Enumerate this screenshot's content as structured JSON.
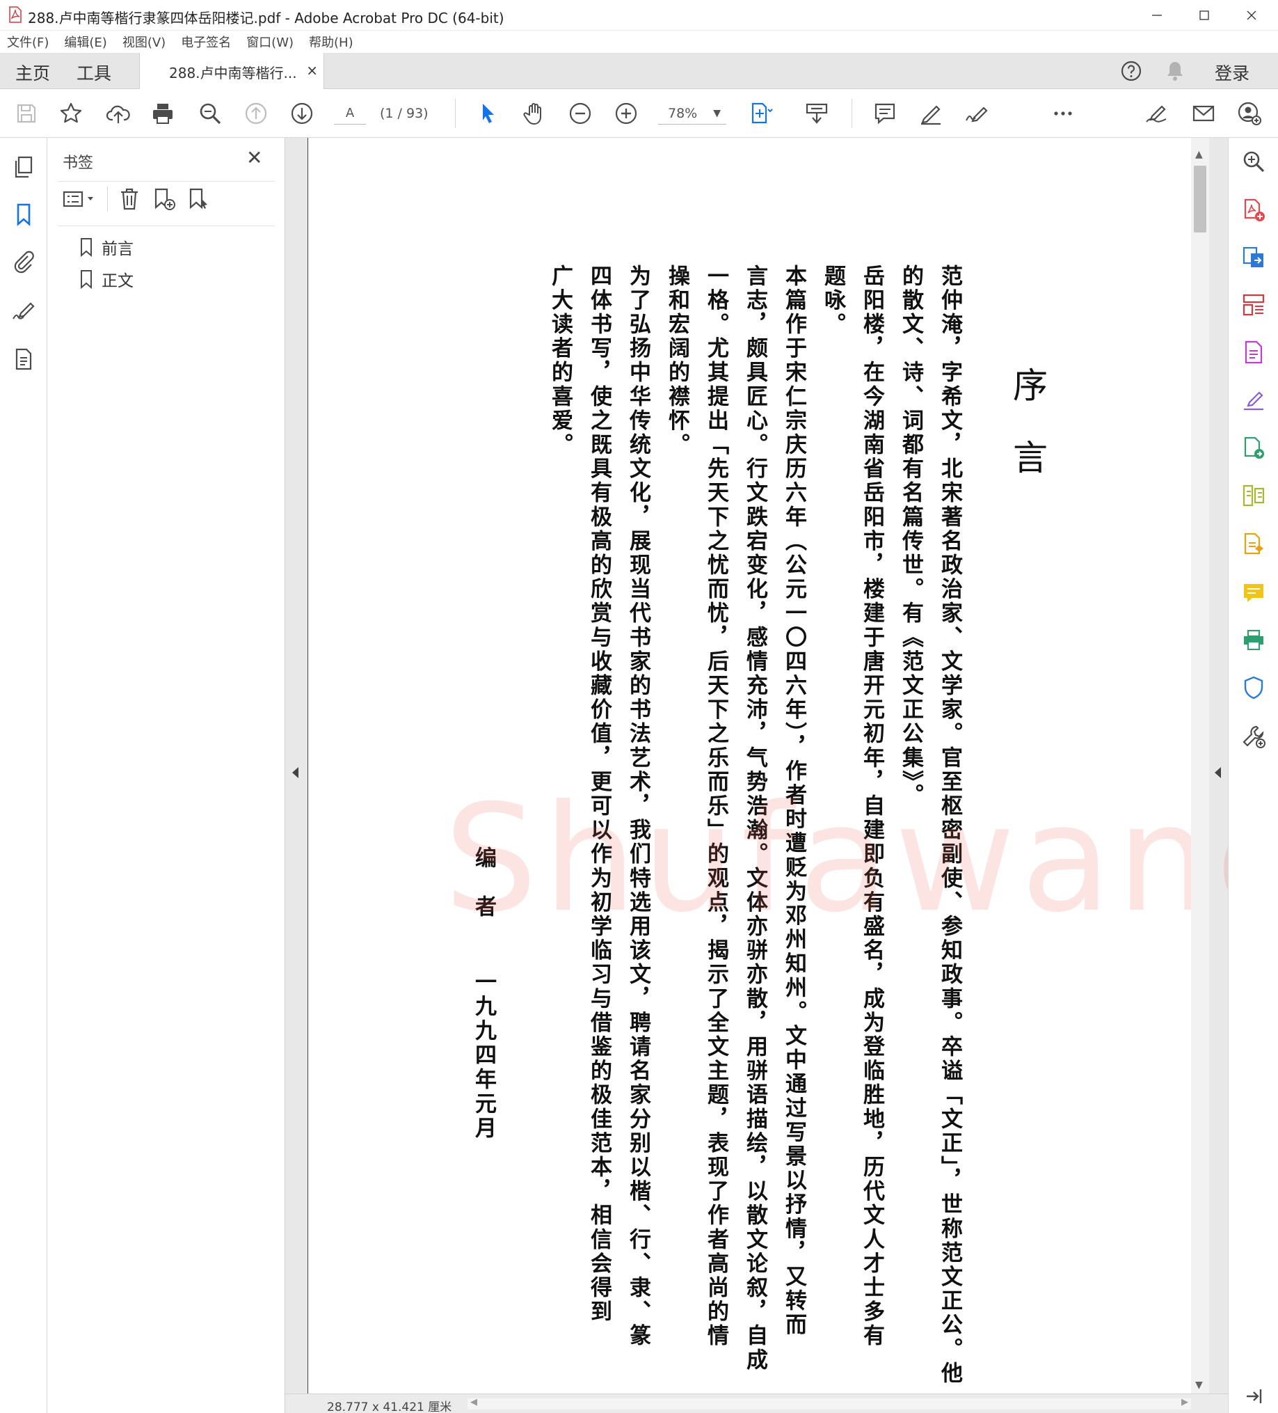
{
  "window": {
    "title": "288.卢中南等楷行隶篆四体岳阳楼记.pdf - Adobe Acrobat Pro DC (64-bit)"
  },
  "menu": [
    "文件(F)",
    "编辑(E)",
    "视图(V)",
    "电子签名",
    "窗口(W)",
    "帮助(H)"
  ],
  "tabs": {
    "home": "主页",
    "tools": "工具",
    "document": "288.卢中南等楷行...",
    "close": "×",
    "login": "登录"
  },
  "toolbar": {
    "page_input": "A",
    "page_count": "(1 / 93)",
    "zoom": "78%"
  },
  "bookmarks": {
    "title": "书签",
    "close": "✕",
    "items": [
      "前言",
      "正文"
    ]
  },
  "page": {
    "heading": [
      "序",
      "言"
    ],
    "columns": [
      "范仲淹，字希文，北宋著名政治家、文学家。官至枢密副使、参知政事。卒谥「文正」，世称范文正公。他",
      "的散文、诗、词都有名篇传世。有《范文正公集》。",
      "岳阳楼，在今湖南省岳阳市，楼建于唐开元初年，自建即负有盛名，成为登临胜地，历代文人才士多有",
      "题咏。",
      "本篇作于宋仁宗庆历六年（公元一〇四六年），作者时遭贬为邓州知州。文中通过写景以抒情，又转而",
      "言志，颇具匠心。行文跌宕变化，感情充沛，气势浩瀚。文体亦骈亦散，用骈语描绘，以散文论叙，自成",
      "一格。尤其提出「先天下之忧而忧，后天下之乐而乐」的观点，揭示了全文主题，表现了作者高尚的情",
      "操和宏阔的襟怀。",
      "为了弘扬中华传统文化，展现当代书家的书法艺术，我们特选用该文，聘请名家分别以楷、行、隶、篆",
      "四体书写，使之既具有极高的欣赏与收藏价值，更可以作为初学临习与借鉴的极佳范本，相信会得到",
      "广大读者的喜爱。"
    ],
    "signature": [
      "编",
      "者"
    ],
    "date": "一九九四年元月"
  },
  "watermark": "Shufawang.CN",
  "status": {
    "dimensions": "28.777 x 41.421 厘米"
  },
  "colors": {
    "accent_blue": "#1473e6",
    "icon_gray": "#4b4b4b",
    "pdf_red": "#d7373f",
    "watermark": "#ec5a50"
  }
}
